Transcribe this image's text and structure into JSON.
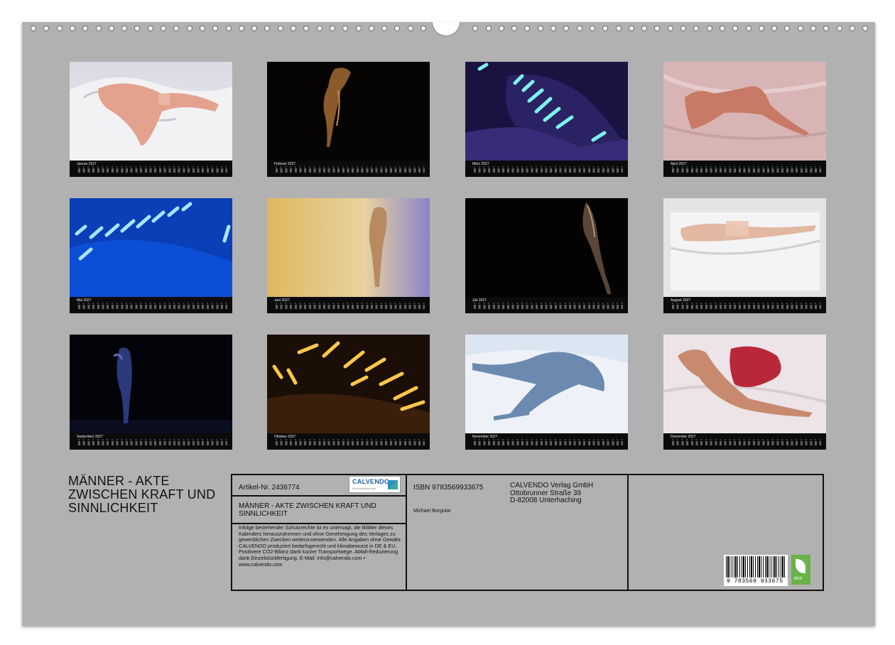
{
  "title_lines": [
    "MÄNNER - AKTE",
    "ZWISCHEN KRAFT UND",
    "SINNLICHKEIT"
  ],
  "months": [
    {
      "label": "Januar 2027"
    },
    {
      "label": "Februar 2027"
    },
    {
      "label": "März 2027"
    },
    {
      "label": "April 2027"
    },
    {
      "label": "Mai 2027"
    },
    {
      "label": "Juni 2027"
    },
    {
      "label": "Juli 2027"
    },
    {
      "label": "August 2027"
    },
    {
      "label": "September 2027"
    },
    {
      "label": "Oktober 2027"
    },
    {
      "label": "November 2027"
    },
    {
      "label": "Dezember 2027"
    }
  ],
  "info": {
    "article": "Artikel-Nr. 2436774",
    "logo_name": "CALVENDO",
    "logo_sub": "best wandkalender",
    "title": "MÄNNER - AKTE ZWISCHEN KRAFT UND SINNLICHKEIT",
    "legal": "Infolge bestehender Schutzrechte ist es untersagt, die Blätter dieses Kalenders herauszutrennen und ohne Genehmigung des Verlages zu gewerblichen Zwecken weiterzuverwenden. Alle Angaben ohne Gewähr. CALVENDO produziert bedarfsgerecht und klimabewusst in DE & EU. Positivere CO2-Bilanz dank kurzer Transportwege. Abfall-Reduzierung dank Einzelstückfertigung. E-Mail: info@calvendo.com • www.calvendo.com",
    "isbn": "ISBN 9783569933675",
    "author": "Michael Borgulat",
    "publisher": [
      "CALVENDO Verlag GmbH",
      "Ottobrunner Straße 39",
      "D-82008 Unterhaching"
    ],
    "barcode_number": "9 783569 933675",
    "eco_label": "eco"
  }
}
